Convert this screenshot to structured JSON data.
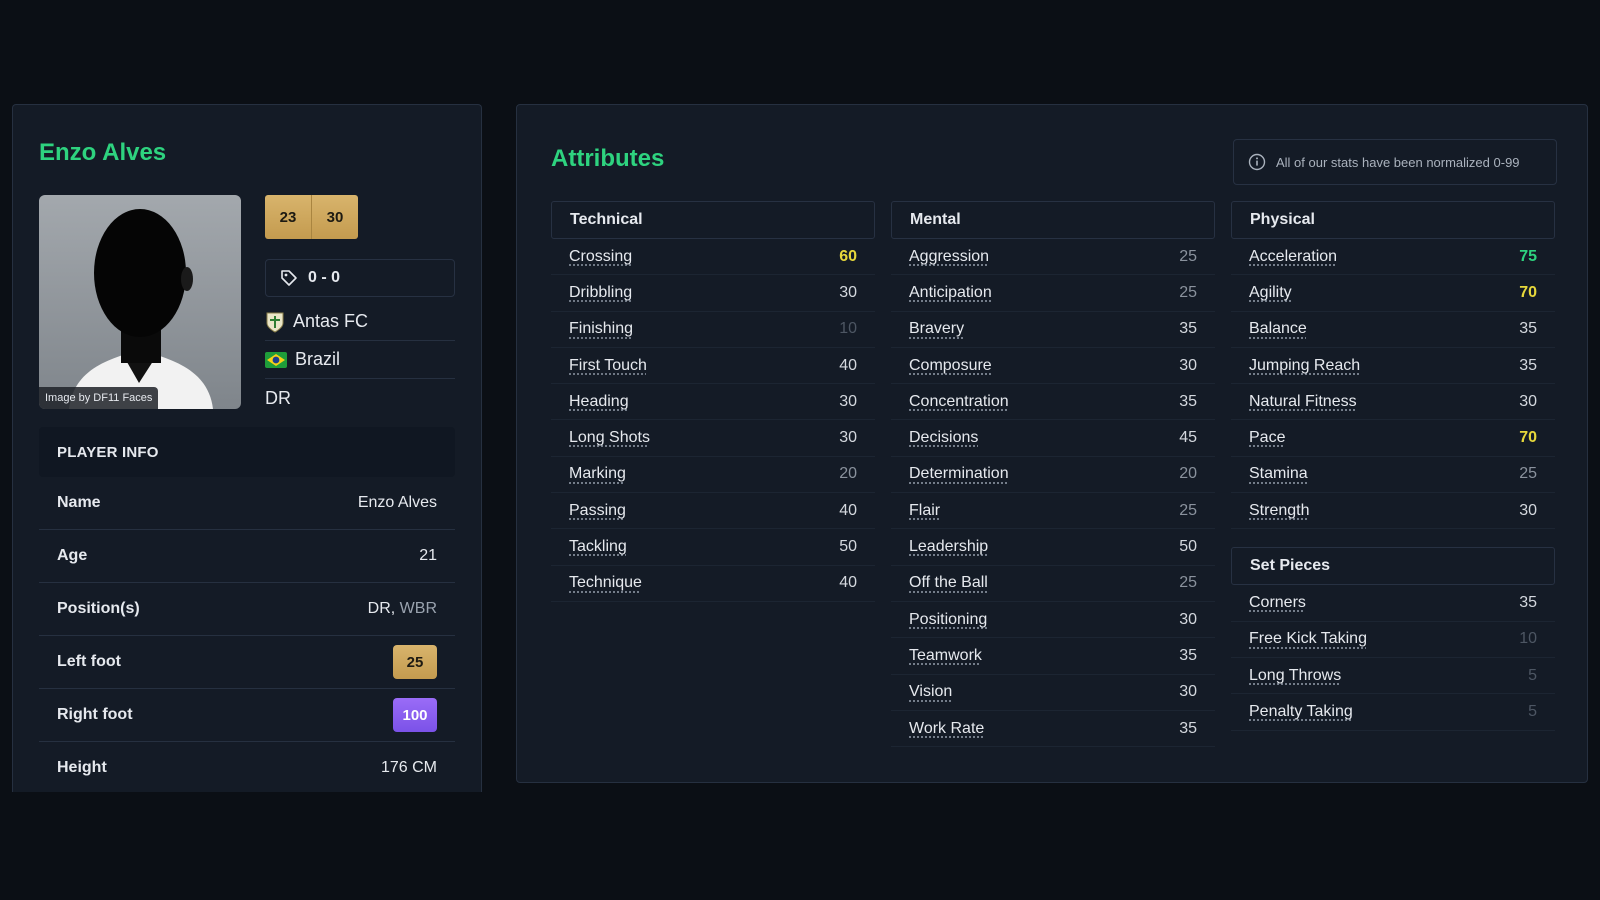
{
  "player": {
    "name": "Enzo Alves",
    "image_credit": "Image by DF11 Faces",
    "badges": [
      "23",
      "30"
    ],
    "value": "0 - 0",
    "club": "Antas FC",
    "nationality": "Brazil",
    "position_short": "DR"
  },
  "player_info": {
    "heading": "PLAYER INFO",
    "name_label": "Name",
    "name_value": "Enzo Alves",
    "age_label": "Age",
    "age_value": "21",
    "positions_label": "Position(s)",
    "positions_primary": "DR",
    "positions_secondary": "WBR",
    "left_foot_label": "Left foot",
    "left_foot_value": "25",
    "right_foot_label": "Right foot",
    "right_foot_value": "100",
    "height_label": "Height",
    "height_value": "176 CM"
  },
  "attributes": {
    "title": "Attributes",
    "note": "All of our stats have been normalized 0-99",
    "technical": {
      "heading": "Technical",
      "rows": [
        {
          "name": "Crossing",
          "value": "60",
          "tier": "good"
        },
        {
          "name": "Dribbling",
          "value": "30",
          "tier": "norm"
        },
        {
          "name": "Finishing",
          "value": "10",
          "tier": "vlow"
        },
        {
          "name": "First Touch",
          "value": "40",
          "tier": "norm"
        },
        {
          "name": "Heading",
          "value": "30",
          "tier": "norm"
        },
        {
          "name": "Long Shots",
          "value": "30",
          "tier": "norm"
        },
        {
          "name": "Marking",
          "value": "20",
          "tier": "low"
        },
        {
          "name": "Passing",
          "value": "40",
          "tier": "norm"
        },
        {
          "name": "Tackling",
          "value": "50",
          "tier": "norm"
        },
        {
          "name": "Technique",
          "value": "40",
          "tier": "norm"
        }
      ]
    },
    "mental": {
      "heading": "Mental",
      "rows": [
        {
          "name": "Aggression",
          "value": "25",
          "tier": "low"
        },
        {
          "name": "Anticipation",
          "value": "25",
          "tier": "low"
        },
        {
          "name": "Bravery",
          "value": "35",
          "tier": "norm"
        },
        {
          "name": "Composure",
          "value": "30",
          "tier": "norm"
        },
        {
          "name": "Concentration",
          "value": "35",
          "tier": "norm"
        },
        {
          "name": "Decisions",
          "value": "45",
          "tier": "norm"
        },
        {
          "name": "Determination",
          "value": "20",
          "tier": "low"
        },
        {
          "name": "Flair",
          "value": "25",
          "tier": "low"
        },
        {
          "name": "Leadership",
          "value": "50",
          "tier": "norm"
        },
        {
          "name": "Off the Ball",
          "value": "25",
          "tier": "low"
        },
        {
          "name": "Positioning",
          "value": "30",
          "tier": "norm"
        },
        {
          "name": "Teamwork",
          "value": "35",
          "tier": "norm"
        },
        {
          "name": "Vision",
          "value": "30",
          "tier": "norm"
        },
        {
          "name": "Work Rate",
          "value": "35",
          "tier": "norm"
        }
      ]
    },
    "physical": {
      "heading": "Physical",
      "rows": [
        {
          "name": "Acceleration",
          "value": "75",
          "tier": "high"
        },
        {
          "name": "Agility",
          "value": "70",
          "tier": "good"
        },
        {
          "name": "Balance",
          "value": "35",
          "tier": "norm"
        },
        {
          "name": "Jumping Reach",
          "value": "35",
          "tier": "norm"
        },
        {
          "name": "Natural Fitness",
          "value": "30",
          "tier": "norm"
        },
        {
          "name": "Pace",
          "value": "70",
          "tier": "good"
        },
        {
          "name": "Stamina",
          "value": "25",
          "tier": "low"
        },
        {
          "name": "Strength",
          "value": "30",
          "tier": "norm"
        }
      ]
    },
    "set_pieces": {
      "heading": "Set Pieces",
      "rows": [
        {
          "name": "Corners",
          "value": "35",
          "tier": "norm"
        },
        {
          "name": "Free Kick Taking",
          "value": "10",
          "tier": "vlow"
        },
        {
          "name": "Long Throws",
          "value": "5",
          "tier": "vlow"
        },
        {
          "name": "Penalty Taking",
          "value": "5",
          "tier": "vlow"
        }
      ]
    }
  },
  "colors": {
    "accent": "#2ed37f",
    "good": "#e7d83b",
    "gold": "#c49b4f",
    "purple": "#7b52e8",
    "background": "#0b0f15",
    "card": "#141b26"
  },
  "icons": {
    "value": "tag-icon",
    "club": "club-crest-icon",
    "nation": "brazil-flag-icon",
    "note": "info-icon"
  }
}
